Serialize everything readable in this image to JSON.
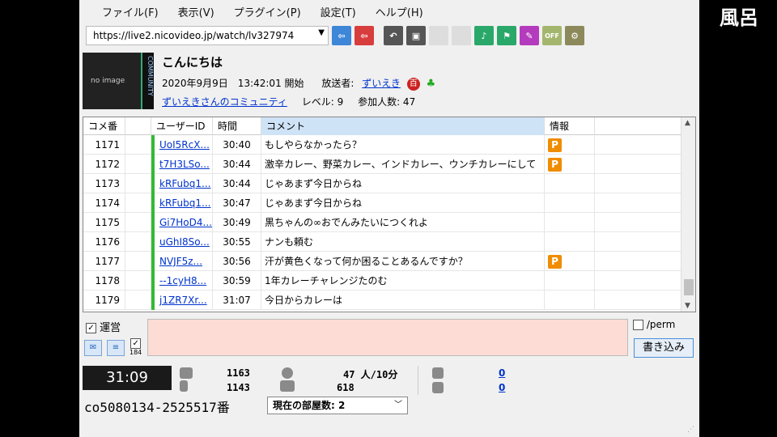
{
  "overlay_text": "風呂",
  "menu": [
    "ファイル(F)",
    "表示(V)",
    "プラグイン(P)",
    "設定(T)",
    "ヘルプ(H)"
  ],
  "url": "https://live2.nicovideo.jp/watch/lv327974",
  "broadcast": {
    "thumb_text": "no image",
    "community_tag": "COMMUNITY",
    "title": "こんにちは",
    "start_time": "2020年9月9日　13:42:01 開始",
    "broadcaster_label": "放送者:",
    "broadcaster_name": "ずいえき",
    "community_name": "ずいえきさんのコミュニティ",
    "level": "レベル: 9",
    "participants": "参加人数: 47"
  },
  "table": {
    "headers": [
      "コメ番",
      "",
      "ユーザーID",
      "時間",
      "コメント",
      "情報"
    ],
    "rows": [
      {
        "no": "1171",
        "uid": "UoI5RcX...",
        "time": "30:40",
        "comment": "もしやらなかったら？",
        "info": "P"
      },
      {
        "no": "1172",
        "uid": "t7H3LSo...",
        "time": "30:44",
        "comment": "激辛カレー、野菜カレー、インドカレー、ウンチカレーにして",
        "info": "P"
      },
      {
        "no": "1173",
        "uid": "kRFubq1...",
        "time": "30:44",
        "comment": "じゃあまず今日からね",
        "info": ""
      },
      {
        "no": "1174",
        "uid": "kRFubq1...",
        "time": "30:47",
        "comment": "じゃあまず今日からね",
        "info": ""
      },
      {
        "no": "1175",
        "uid": "Gi7HoD4...",
        "time": "30:49",
        "comment": "黒ちゃんの∞おでんみたいにつくれよ",
        "info": ""
      },
      {
        "no": "1176",
        "uid": "uGhI8So...",
        "time": "30:55",
        "comment": "ナンも頼む",
        "info": ""
      },
      {
        "no": "1177",
        "uid": "NVJF5z...",
        "time": "30:56",
        "comment": "汗が黄色くなって何か困ることあるんですか？",
        "info": "P"
      },
      {
        "no": "1178",
        "uid": "--1cyH8...",
        "time": "30:59",
        "comment": "1年カレーチャレンジたのむ",
        "info": ""
      },
      {
        "no": "1179",
        "uid": "j1ZR7Xr...",
        "time": "31:07",
        "comment": "今日からカレーは",
        "info": ""
      }
    ]
  },
  "controls": {
    "unei_label": "運営",
    "perm_label": "/perm",
    "submit_label": "書き込み",
    "comment_placeholder": "",
    "ikon_label": "184"
  },
  "status": {
    "elapsed": "31:09",
    "comment_count": "1163",
    "comment_count2": "1143",
    "viewers": "47 人/10分",
    "viewers_total": "618",
    "ad_points": "0",
    "gift_points": "0",
    "code": "co5080134-2525517番",
    "rooms": "現在の部屋数: 2"
  },
  "colors": {
    "accent": "#0033cc",
    "premium_badge": "#f08c00",
    "comment_input": "#fddcd6",
    "active_header": "#cfe3f7"
  }
}
